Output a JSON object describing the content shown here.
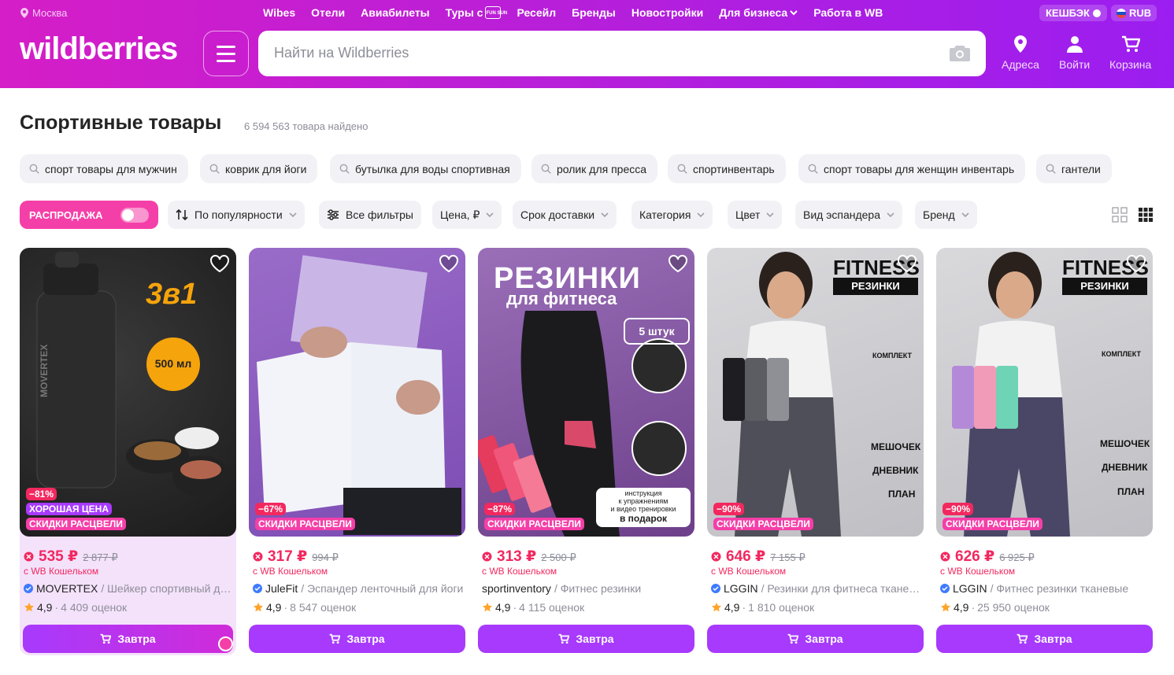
{
  "header": {
    "location": "Москва",
    "nav": [
      "Wibes",
      "Отели",
      "Авиабилеты",
      "Туры с",
      "Ресейл",
      "Бренды",
      "Новостройки",
      "Для бизнеса",
      "Работа в WB"
    ],
    "fun_logo": "FUN SUN",
    "cashback": "КЕШБЭК",
    "currency": "RUB",
    "logo": "wildberries",
    "search_placeholder": "Найти на Wildberries",
    "addresses": "Адреса",
    "login": "Войти",
    "cart": "Корзина"
  },
  "page": {
    "title": "Спортивные товары",
    "count": "6 594 563 товара найдено"
  },
  "suggestions": [
    "спорт товары для мужчин",
    "коврик для йоги",
    "бутылка для воды спортивная",
    "ролик для пресса",
    "спортинвентарь",
    "спорт товары для женщин инвентарь",
    "гантели"
  ],
  "filters": {
    "sale_label": "РАСПРОДАЖА",
    "items": [
      "По популярности",
      "Все фильтры",
      "Цена, ₽",
      "Срок доставки",
      "Категория",
      "Цвет",
      "Вид эспандера",
      "Бренд"
    ]
  },
  "products": [
    {
      "discount": "−81%",
      "good_price": "ХОРОШАЯ ЦЕНА",
      "sale_badge": "СКИДКИ РАСЦВЕЛИ",
      "price": "535 ₽",
      "old_price": "2 877 ₽",
      "wallet": "с WB Кошельком",
      "brand": "MOVERTEX",
      "desc": " / Шейкер спортивный для протеина",
      "rating": "4,9",
      "reviews": "4 409 оценок",
      "button": "Завтра",
      "image": {
        "big": "3в1",
        "circle": "500 мл",
        "maker": "MOVERTEX"
      }
    },
    {
      "discount": "−67%",
      "sale_badge": "СКИДКИ РАСЦВЕЛИ",
      "price": "317 ₽",
      "old_price": "994 ₽",
      "wallet": "с WB Кошельком",
      "brand": "JuleFit",
      "desc": " / Эспандер ленточный для йоги",
      "rating": "4,9",
      "reviews": "8 547 оценок",
      "button": "Завтра"
    },
    {
      "discount": "−87%",
      "sale_badge": "СКИДКИ РАСЦВЕЛИ",
      "price": "313 ₽",
      "old_price": "2 500 ₽",
      "wallet": "с WB Кошельком",
      "brand": "sportinventory",
      "desc": " / Фитнес резинки",
      "rating": "4,9",
      "reviews": "4 115 оценок",
      "button": "Завтра",
      "image": {
        "title1": "РЕЗИНКИ",
        "title2": "для фитнеса",
        "count": "5 штук",
        "gift1": "инструкция",
        "gift2": "к упражнениям",
        "gift3": "и видео тренировки",
        "gift4": "в подарок"
      }
    },
    {
      "discount": "−90%",
      "sale_badge": "СКИДКИ РАСЦВЕЛИ",
      "price": "646 ₽",
      "old_price": "7 155 ₽",
      "wallet": "с WB Кошельком",
      "brand": "LGGIN",
      "desc": " / Резинки для фитнеса тканевые",
      "rating": "4,9",
      "reviews": "1 810 оценок",
      "button": "Завтра",
      "image": {
        "title": "FITNESS",
        "sub": "РЕЗИНКИ",
        "kit": "КОМПЛЕКТ",
        "l1": "МЕШОЧЕК",
        "l2": "ДНЕВНИК",
        "l3": "ПЛАН"
      }
    },
    {
      "discount": "−90%",
      "sale_badge": "СКИДКИ РАСЦВЕЛИ",
      "price": "626 ₽",
      "old_price": "6 925 ₽",
      "wallet": "с WB Кошельком",
      "brand": "LGGIN",
      "desc": " / Фитнес резинки тканевые",
      "rating": "4,9",
      "reviews": "25 950 оценок",
      "button": "Завтра",
      "image": {
        "title": "FITNESS",
        "sub": "РЕЗИНКИ",
        "kit": "КОМПЛЕКТ",
        "l1": "МЕШОЧЕК",
        "l2": "ДНЕВНИК",
        "l3": "ПЛАН"
      }
    }
  ],
  "colors": {
    "brand_gradient_start": "#d51ec7",
    "brand_gradient_end": "#9b1ef0",
    "price": "#f2285f",
    "button": "#a73afd",
    "sale": "#f53fa8"
  },
  "icons": [
    "pin-icon",
    "menu-icon",
    "camera-icon",
    "address-icon",
    "user-icon",
    "cart-icon",
    "search-icon",
    "sort-icon",
    "filters-icon",
    "chevron-down-icon",
    "grid-view-icon",
    "heart-icon",
    "star-icon",
    "verified-icon"
  ]
}
